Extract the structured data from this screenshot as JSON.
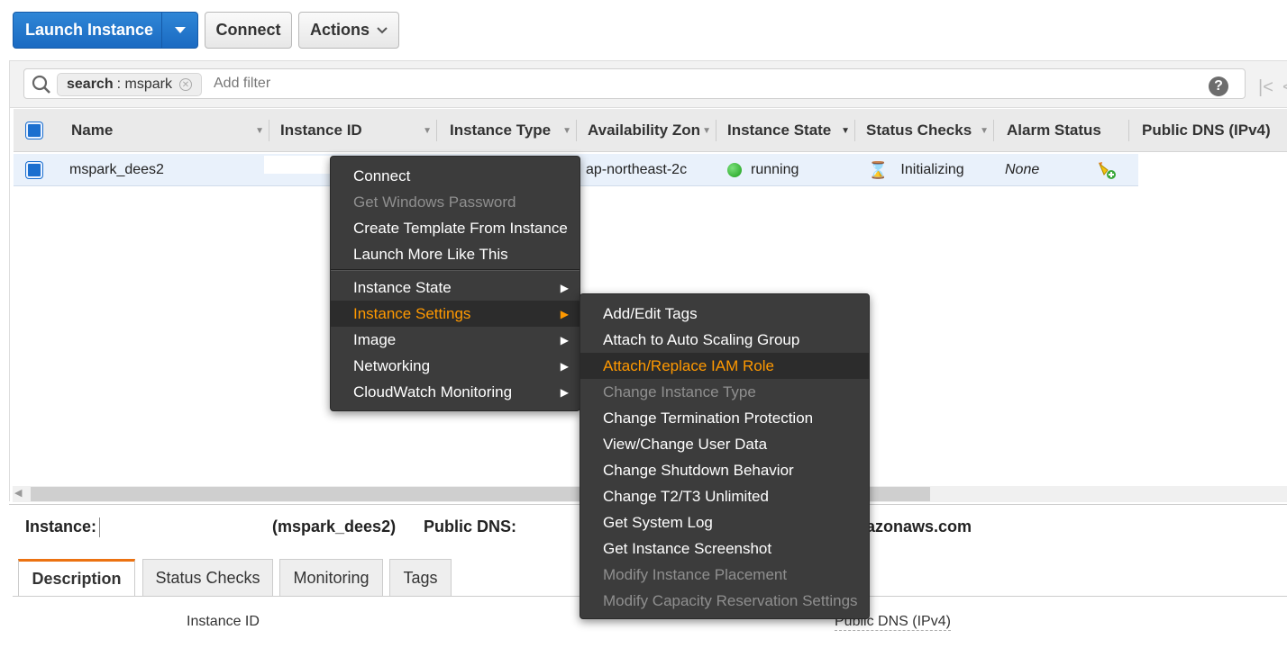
{
  "toolbar": {
    "launch_label": "Launch Instance",
    "connect_label": "Connect",
    "actions_label": "Actions"
  },
  "search": {
    "chip_key": "search",
    "chip_value": ": mspark",
    "placeholder": "Add filter"
  },
  "table": {
    "columns": [
      "Name",
      "Instance ID",
      "Instance Type",
      "Availability Zone",
      "Instance State",
      "Status Checks",
      "Alarm Status",
      "Public DNS (IPv4)"
    ],
    "row": {
      "name": "mspark_dees2",
      "availability_zone": "ap-northeast-2c",
      "instance_state": "running",
      "status_checks": "Initializing",
      "alarm_status": "None"
    }
  },
  "context_menu": {
    "items": [
      {
        "label": "Connect",
        "disabled": false
      },
      {
        "label": "Get Windows Password",
        "disabled": true
      },
      {
        "label": "Create Template From Instance",
        "disabled": false
      },
      {
        "label": "Launch More Like This",
        "disabled": false
      },
      {
        "label": "Instance State",
        "disabled": false
      },
      {
        "label": "Instance Settings",
        "disabled": false
      },
      {
        "label": "Image",
        "disabled": false
      },
      {
        "label": "Networking",
        "disabled": false
      },
      {
        "label": "CloudWatch Monitoring",
        "disabled": false
      }
    ]
  },
  "submenu": {
    "items": [
      {
        "label": "Add/Edit Tags",
        "disabled": false
      },
      {
        "label": "Attach to Auto Scaling Group",
        "disabled": false
      },
      {
        "label": "Attach/Replace IAM Role",
        "disabled": false
      },
      {
        "label": "Change Instance Type",
        "disabled": true
      },
      {
        "label": "Change Termination Protection",
        "disabled": false
      },
      {
        "label": "View/Change User Data",
        "disabled": false
      },
      {
        "label": "Change Shutdown Behavior",
        "disabled": false
      },
      {
        "label": "Change T2/T3 Unlimited",
        "disabled": false
      },
      {
        "label": "Get System Log",
        "disabled": false
      },
      {
        "label": "Get Instance Screenshot",
        "disabled": false
      },
      {
        "label": "Modify Instance Placement",
        "disabled": true
      },
      {
        "label": "Modify Capacity Reservation Settings",
        "disabled": true
      }
    ]
  },
  "details": {
    "instance_label": "Instance:",
    "instance_name": "(mspark_dees2)",
    "public_dns_label": "Public DNS:",
    "public_dns_tail": "nazonaws.com",
    "tabs": [
      "Description",
      "Status Checks",
      "Monitoring",
      "Tags"
    ],
    "field_instance_id": "Instance ID",
    "field_public_dns": "Public DNS (IPv4)"
  },
  "colors": {
    "primary_blue": "#1a6ac2",
    "menu_bg": "#3c3c3c",
    "menu_highlight": "#ff9900",
    "tab_accent": "#ec7211",
    "selected_row": "#e9f1fb"
  }
}
